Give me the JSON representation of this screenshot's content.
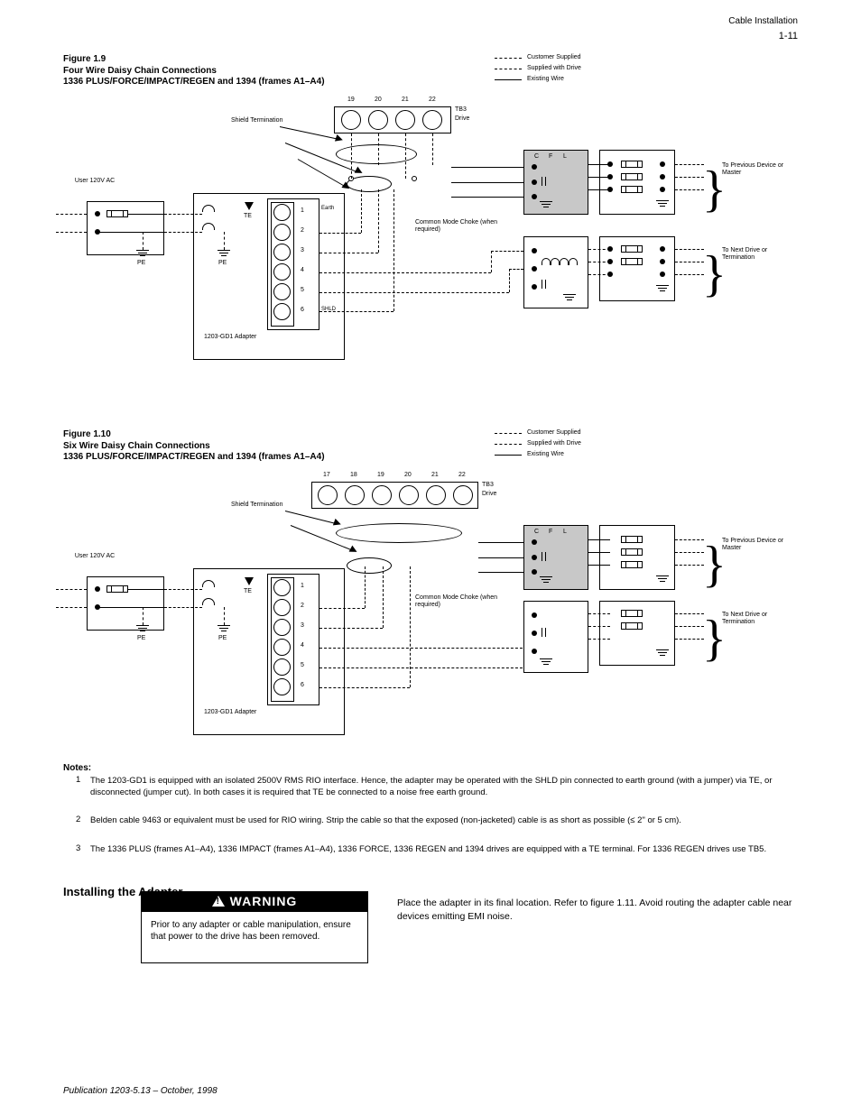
{
  "page": {
    "footer_left": "Publication 1203-5.13 – October, 1998",
    "page_number": "1-11",
    "header_right": "Cable Installation"
  },
  "figures": {
    "fig1": {
      "num": "Figure 1.9",
      "title": "Four Wire Daisy Chain Connections"
    },
    "fig2": {
      "num": "Figure 1.10",
      "title": "Six Wire Daisy Chain Connections"
    },
    "common_subtitle": "1336 PLUS/FORCE/IMPACT/REGEN and 1394 (frames A1–A4)"
  },
  "legend": {
    "customer": "Customer Supplied",
    "included": "Supplied with Drive",
    "existing": "Existing Wire"
  },
  "diagram": {
    "common_label": "Common Mode Choke (when required)",
    "user_power": "User 120V AC",
    "adapter": "1203-GD1 Adapter",
    "te": "TE",
    "pe": "PE",
    "pins": [
      "1",
      "2",
      "3",
      "4",
      "5",
      "6"
    ],
    "earth": "Earth",
    "tb3": "TB3",
    "tb3_pins_4": [
      "19",
      "20",
      "21",
      "22"
    ],
    "tb3_pins_6": [
      "17",
      "18",
      "19",
      "20",
      "21",
      "22"
    ],
    "drive": "Drive",
    "shield": "SHLD",
    "shield_termination": "Shield Termination",
    "filter": {
      "C": "C",
      "F": "F",
      "L": "L"
    },
    "to_prev": "To Previous Device or Master",
    "to_next": "To Next Drive or Termination"
  },
  "notes_heading": "Notes:",
  "notes": [
    {
      "n": "1",
      "t": "The 1203-GD1 is equipped with an isolated 2500V RMS RIO interface. Hence, the adapter may be operated with the SHLD pin connected to earth ground (with a jumper) via TE, or disconnected (jumper cut). In both cases it is required that TE be connected to a noise free earth ground."
    },
    {
      "n": "2",
      "t": "Belden cable 9463 or equivalent must be used for RIO wiring. Strip the cable so that the exposed (non-jacketed) cable is as short as possible (≤ 2\" or 5 cm)."
    },
    {
      "n": "3",
      "t": "The 1336 PLUS (frames A1–A4), 1336 IMPACT (frames A1–A4), 1336 FORCE, 1336 REGEN and 1394 drives are equipped with a TE terminal. For 1336 REGEN drives use TB5."
    }
  ],
  "install_heading": "Installing the Adapter",
  "warning_title": "WARNING",
  "warning_text": "Prior to any adapter or cable manipulation, ensure that power to the drive has been removed.",
  "install_text": "Place the adapter in its final location. Refer to figure 1.11. Avoid routing the adapter cable near devices emitting EMI noise."
}
